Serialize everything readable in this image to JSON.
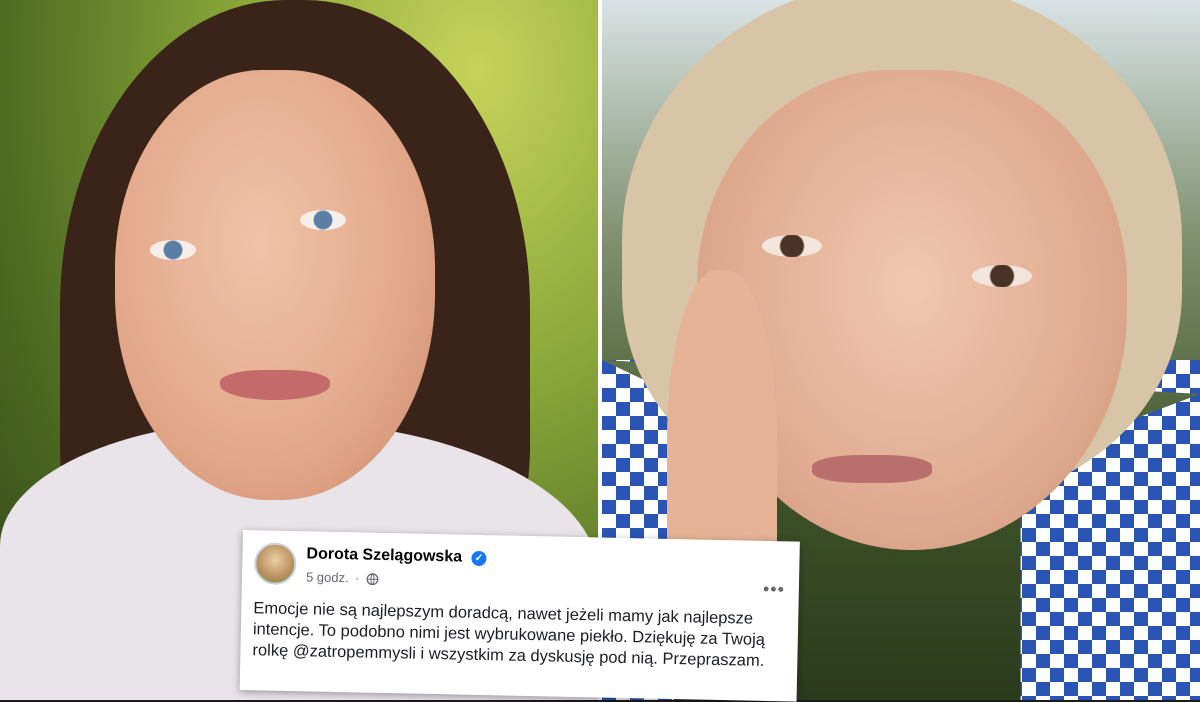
{
  "post": {
    "author": "Dorota Szelągowska",
    "time": "5 godz.",
    "separator": "·",
    "more": "•••",
    "text": "Emocje nie są najlepszym doradcą, nawet jeżeli mamy jak najlepsze intencje. To podobno nimi jest wybrukowane piekło. Dziękuję za Twoją rolkę @zatropemmysli i wszystkim za dyskusję pod nią. Przepraszam.",
    "verified_icon": "verified-badge-icon",
    "visibility_icon": "globe-icon",
    "accent_color": "#1877f2"
  }
}
